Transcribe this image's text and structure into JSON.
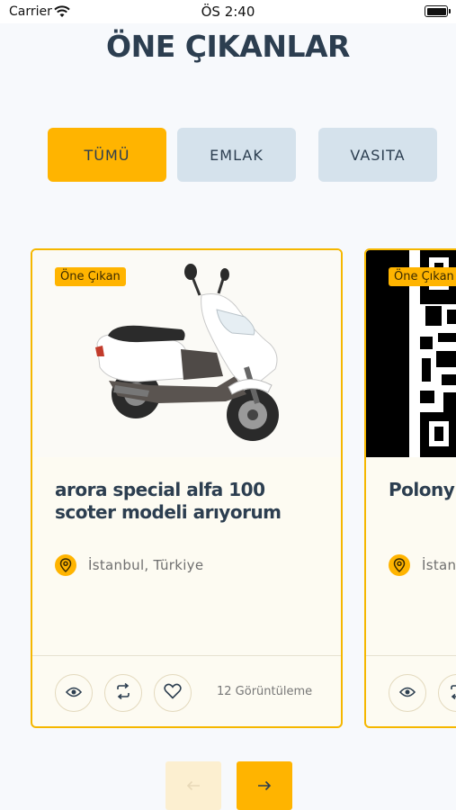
{
  "status_bar": {
    "carrier": "Carrier",
    "time": "ÖS 2:40"
  },
  "page": {
    "title": "ÖNE ÇIKANLAR"
  },
  "tabs": [
    {
      "label": "TÜMÜ",
      "active": true
    },
    {
      "label": "EMLAK",
      "active": false
    },
    {
      "label": "VASITA",
      "active": false
    }
  ],
  "cards": [
    {
      "badge": "Öne Çıkan",
      "image": "scooter-photo",
      "title": "arora special alfa 100 scoter modeli arıyorum",
      "location": "İstanbul, Türkiye",
      "views": "12 Görüntüleme"
    },
    {
      "badge": "Öne Çıkan",
      "image": "qr-code-photo",
      "title": "Polony",
      "location": "İstan"
    }
  ],
  "actions": {
    "icons": [
      "eye-icon",
      "compare-icon",
      "heart-icon"
    ]
  },
  "pagination": {
    "prev_icon": "arrow-left-icon",
    "next_icon": "arrow-right-icon"
  },
  "colors": {
    "accent": "#ffb400",
    "title": "#2c3e50",
    "tab_idle": "#d5e2ec",
    "card_bg": "#fdfbf2"
  }
}
